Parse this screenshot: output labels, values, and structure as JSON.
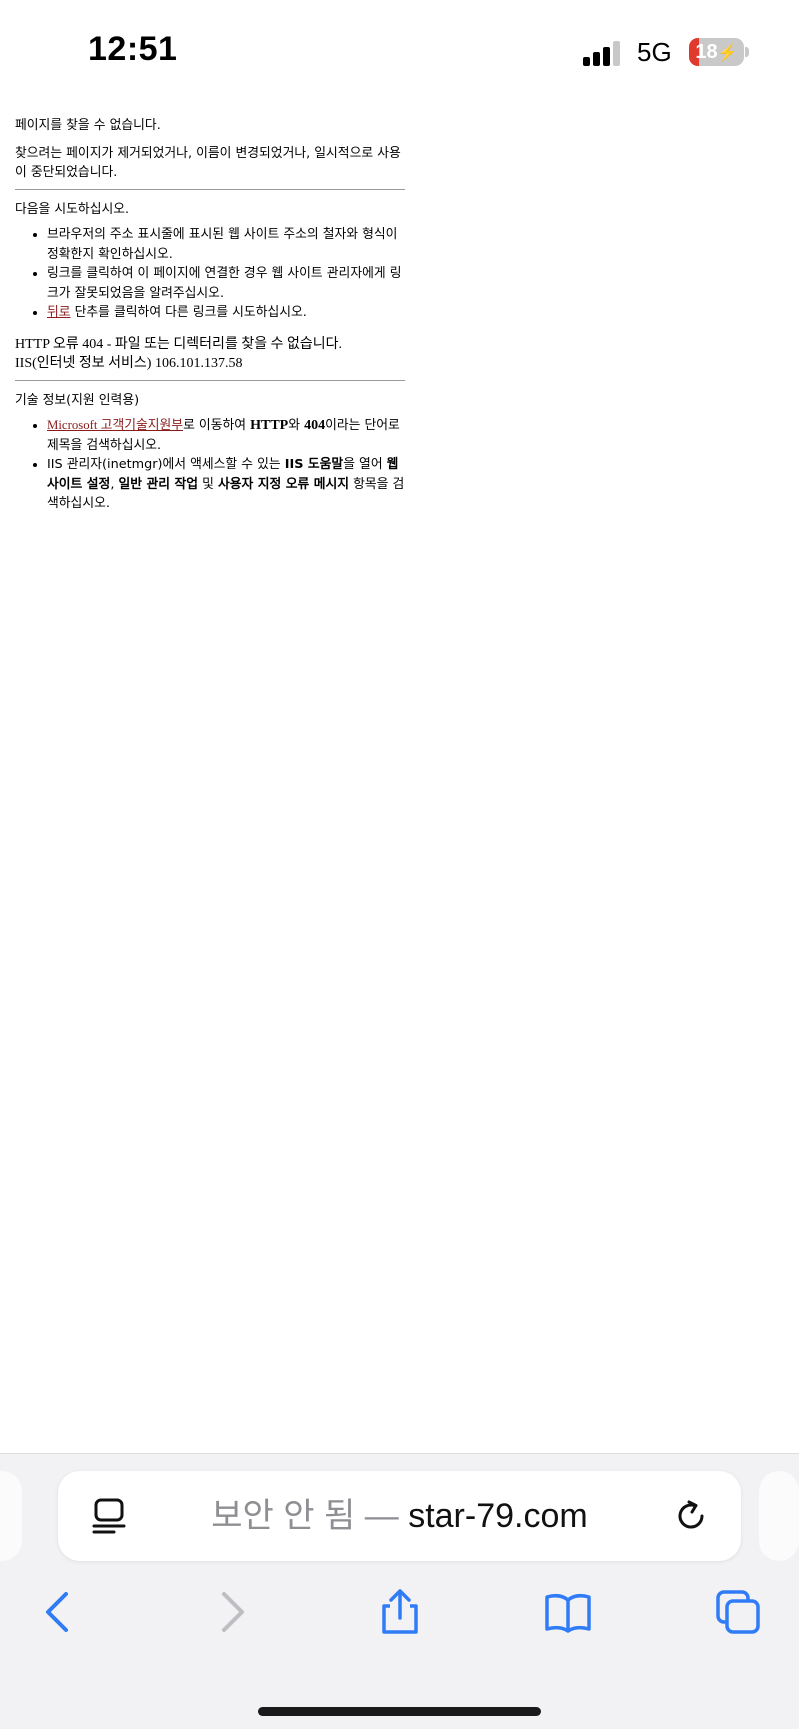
{
  "status_bar": {
    "time": "12:51",
    "network": "5G",
    "battery": "18",
    "battery_level": 0.18,
    "battery_low_color": "#e0392e"
  },
  "page": {
    "title": "페이지를 찾을 수 없습니다.",
    "intro": "찾으려는 페이지가 제거되었거나, 이름이 변경되었거나, 일시적으로 사용이 중단되었습니다.",
    "try_heading": "다음을 시도하십시오.",
    "try_items": [
      "브라우저의 주소 표시줄에 표시된 웹 사이트 주소의 철자와 형식이 정확한지 확인하십시오.",
      "링크를 클릭하여 이 페이지에 연결한 경우 웹 사이트 관리자에게 링크가 잘못되었음을 알려주십시오."
    ],
    "back_link": "뒤로",
    "back_suffix": " 단추를 클릭하여 다른 링크를 시도하십시오.",
    "error_line": "HTTP 오류 404 - 파일 또는 디렉터리를 찾을 수 없습니다.",
    "server_line": "IIS(인터넷 정보 서비스) 106.101.137.58",
    "tech_heading": "기술 정보(지원 인력용)",
    "tech1_link": "Microsoft 고객기술지원부",
    "tech1_a": "로 이동하여 ",
    "tech1_b1": "HTTP",
    "tech1_c": "와 ",
    "tech1_b2": "404",
    "tech1_d": "이라는 단어로 제목을 검색하십시오.",
    "tech2_a": "IIS 관리자(inetmgr)에서 액세스할 수 있는 ",
    "tech2_b1": "IIS 도움말",
    "tech2_c": "을 열어 ",
    "tech2_b2": "웹 사이트 설정",
    "tech2_d": ", ",
    "tech2_b3": "일반 관리 작업",
    "tech2_e": " 및 ",
    "tech2_b4": "사용자 지정 오류 메시지",
    "tech2_f": " 항목을 검색하십시오.",
    "link_color": "#8a1c1c"
  },
  "browser": {
    "not_secure": "보안 안 됨",
    "separator": " — ",
    "domain": "star-79.com",
    "icons": [
      "reader-icon",
      "reload-icon",
      "back-icon",
      "forward-icon",
      "share-icon",
      "bookmarks-icon",
      "tabs-icon"
    ],
    "accent_color": "#2f7cf6"
  }
}
